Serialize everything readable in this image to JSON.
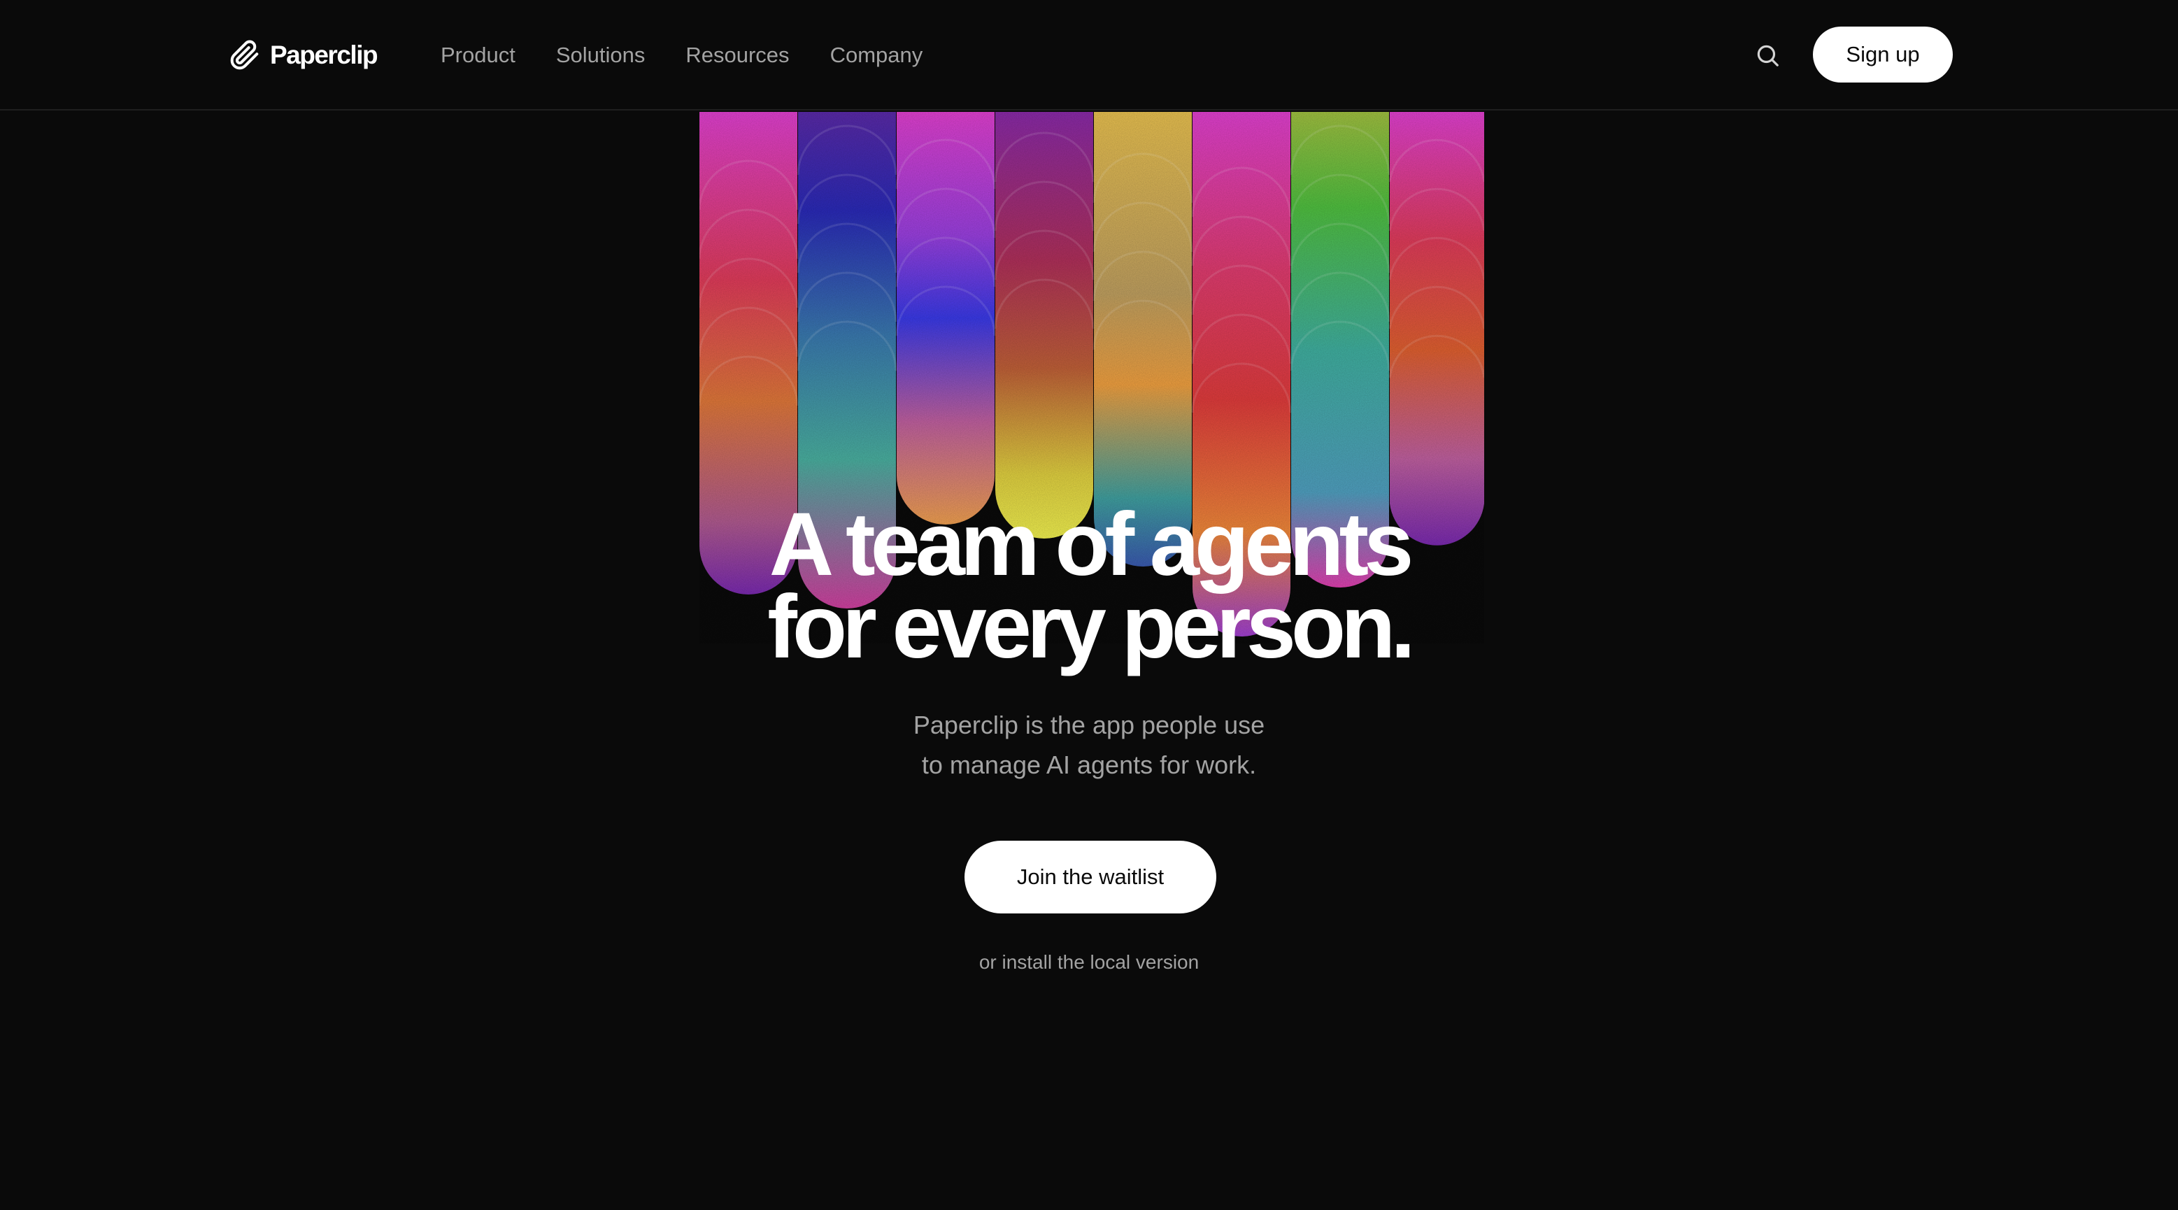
{
  "brand": {
    "name": "Paperclip",
    "logo_icon": "paperclip-icon"
  },
  "nav": {
    "items": [
      {
        "label": "Product"
      },
      {
        "label": "Solutions"
      },
      {
        "label": "Resources"
      },
      {
        "label": "Company"
      }
    ],
    "search_icon": "search-icon",
    "signup_label": "Sign up"
  },
  "hero": {
    "headline_line1": "A team of agents",
    "headline_line2": "for every person.",
    "subtext_line1": "Paperclip is the app people use",
    "subtext_line2": "to manage AI agents for work.",
    "cta_label": "Join the waitlist",
    "secondary_link": "or install the local version"
  },
  "colors": {
    "background": "#0a0a0a",
    "text_primary": "#ffffff",
    "text_muted": "#a3a3a3",
    "button_bg": "#ffffff",
    "button_text": "#0a0a0a"
  }
}
